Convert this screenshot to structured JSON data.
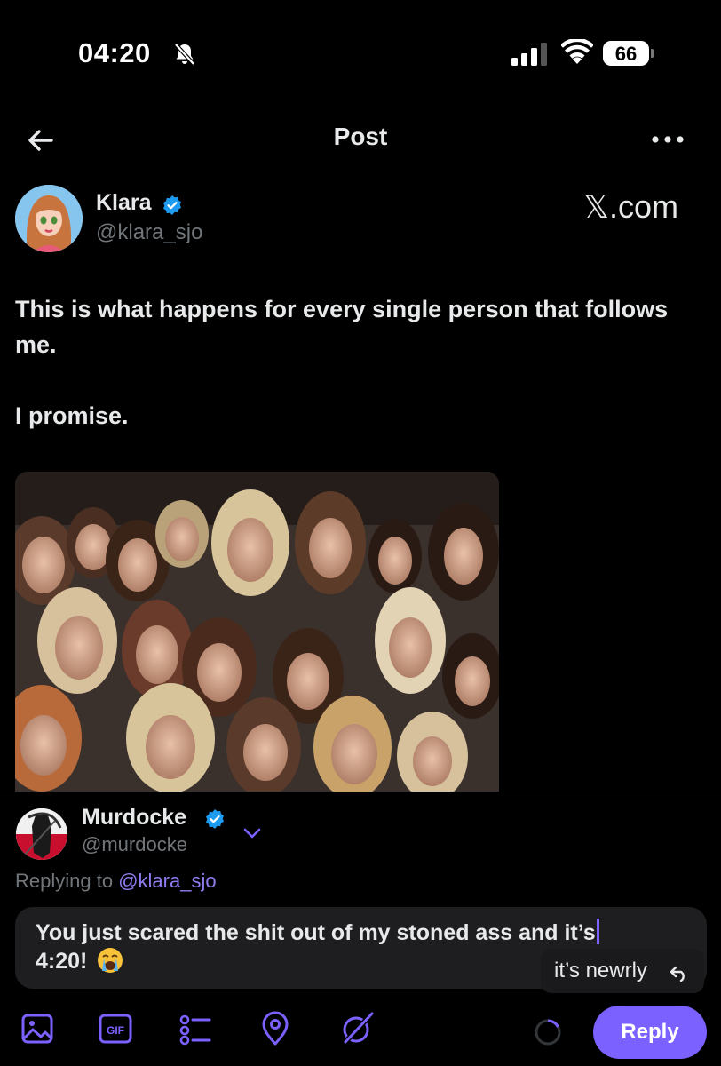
{
  "status_bar": {
    "time": "04:20",
    "battery_level": "66",
    "icons": [
      "bell-slash-icon",
      "signal-icon",
      "wifi-icon",
      "battery-icon"
    ]
  },
  "header": {
    "title": "Post",
    "back_icon": "arrow-left-icon",
    "more_icon": "ellipsis-icon"
  },
  "post": {
    "author": {
      "name": "Klara",
      "handle": "@klara_sjo",
      "verified": true
    },
    "watermark": "𝕏.com",
    "text": "This is what happens for every single person that follows me.\n\nI promise.",
    "media_alt": "photo"
  },
  "composer": {
    "author": {
      "name": "Murdocke",
      "handle": "@murdocke",
      "verified": true
    },
    "replying_prefix": "Replying to",
    "replying_handle": "@klara_sjo",
    "input_value": "You just scared the shit out of my stoned ass and it’s",
    "input_value_line2": "4:20!",
    "autocorrect_suggestion": "it’s newrly",
    "toolbar_icons": [
      "image-icon",
      "gif-icon",
      "poll-icon",
      "location-icon",
      "grok-icon"
    ],
    "reply_button": "Reply"
  },
  "colors": {
    "background": "#000000",
    "accent": "#7b61ff",
    "verified": "#1d9bf0",
    "secondary_text": "#71767b",
    "mention": "#8e7cf0"
  }
}
